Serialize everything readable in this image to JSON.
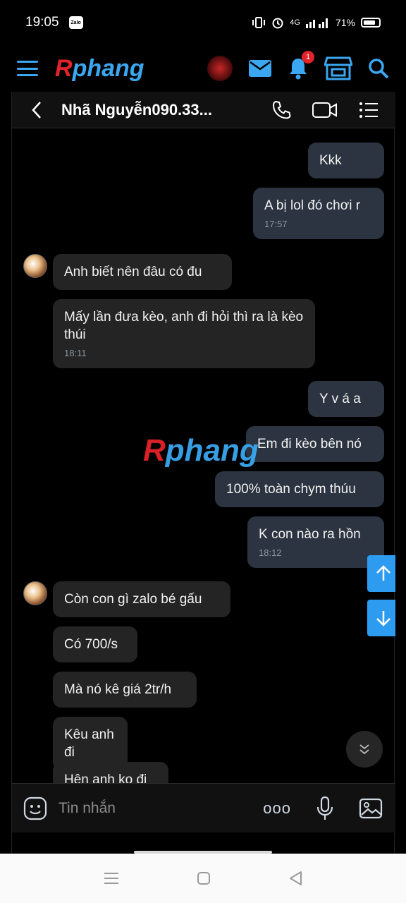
{
  "status_bar": {
    "time": "19:05",
    "app_badge": "Zalo",
    "network": "4G",
    "battery": "71%"
  },
  "forum_bar": {
    "logo_first": "R",
    "logo_rest": "phang",
    "notification_count": "1",
    "icons": [
      "menu-icon",
      "dragon-avatar",
      "mail-icon",
      "bell-icon",
      "store-icon",
      "search-icon"
    ],
    "accent_color": "#3aa7f0",
    "logo_red": "#e3232a"
  },
  "chat": {
    "contact_name": "Nhã Nguyễn090.33...",
    "header_icons": [
      "back-icon",
      "phone-icon",
      "video-icon",
      "list-icon"
    ],
    "watermark_first": "R",
    "watermark_rest": "phang",
    "messages": [
      {
        "dir": "out",
        "text": "Kkk",
        "time": ""
      },
      {
        "dir": "out",
        "text": "A bị lol đó chơi r",
        "time": "17:57"
      },
      {
        "dir": "in",
        "text": "Anh biết nên đâu có đu",
        "time": ""
      },
      {
        "dir": "in",
        "text": "Mấy lần đưa kèo, anh đi hỏi thì ra là kèo thúi",
        "time": "18:11"
      },
      {
        "dir": "out",
        "text": "Y v á a",
        "time": ""
      },
      {
        "dir": "out",
        "text": "Em đi kèo bên nó",
        "time": ""
      },
      {
        "dir": "out",
        "text": "100% toàn chym thúu",
        "time": ""
      },
      {
        "dir": "out",
        "text": "K con nào ra hồn",
        "time": "18:12"
      },
      {
        "dir": "in",
        "text": "Còn con gì zalo bé gấu",
        "time": ""
      },
      {
        "dir": "in",
        "text": "Có 700/s",
        "time": ""
      },
      {
        "dir": "in",
        "text": "Mà nó kê giá 2tr/h",
        "time": ""
      },
      {
        "dir": "in",
        "text": "Kêu anh đi",
        "time": ""
      },
      {
        "dir": "in",
        "text": "Hên anh ko đi",
        "time": ""
      }
    ],
    "composer_placeholder": "Tin nhắn",
    "composer_more": "ooo",
    "out_bubble_color": "#2b3440",
    "in_bubble_color": "#242424"
  },
  "nav_bar": {
    "buttons": [
      "recents-icon",
      "home-icon",
      "back-icon"
    ]
  }
}
